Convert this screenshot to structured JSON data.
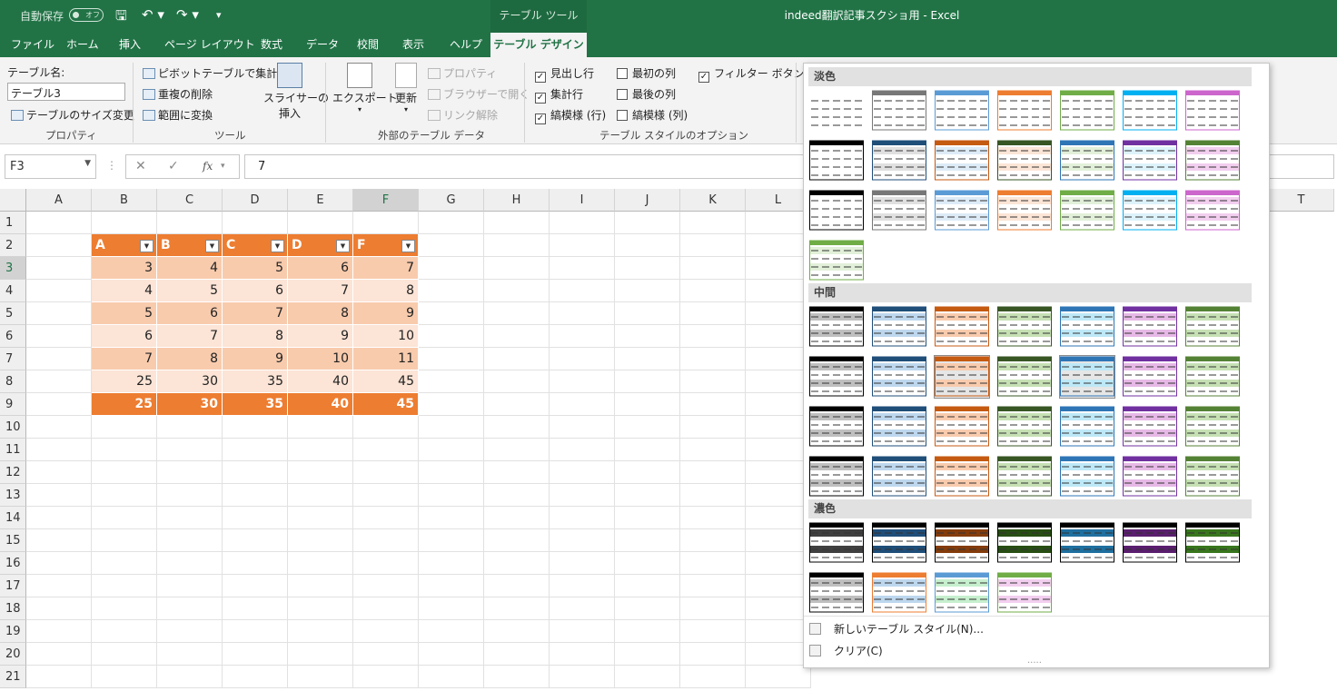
{
  "titlebar": {
    "autosave": "自動保存",
    "toggle": "オフ",
    "tool_tab": "テーブル ツール",
    "doc_title": "indeed翻訳記事スクショ用  -  Excel"
  },
  "menu": [
    "ファイル",
    "ホーム",
    "挿入",
    "ページ レイアウト",
    "数式",
    "データ",
    "校閲",
    "表示",
    "ヘルプ",
    "テーブル デザイン"
  ],
  "ribbon": {
    "prop": {
      "name_label": "テーブル名:",
      "name_value": "テーブル3",
      "resize": "テーブルのサイズ変更",
      "label": "プロパティ"
    },
    "tools": {
      "pivot": "ピボットテーブルで集計",
      "dedupe": "重複の削除",
      "convert": "範囲に変換",
      "slicer1": "スライサーの",
      "slicer2": "挿入",
      "label": "ツール"
    },
    "external": {
      "export": "エクスポート",
      "refresh": "更新",
      "properties": "プロパティ",
      "browser": "ブラウザーで開く",
      "unlink": "リンク解除",
      "label": "外部のテーブル データ"
    },
    "style_options": {
      "header_row": "見出し行",
      "total_row": "集計行",
      "banded_rows": "縞模様 (行)",
      "first_col": "最初の列",
      "last_col": "最後の列",
      "banded_cols": "縞模様 (列)",
      "filter_btn": "フィルター ボタン",
      "label": "テーブル スタイルのオプション"
    }
  },
  "formula": {
    "namebox": "F3",
    "fx": "fx",
    "value": "7"
  },
  "columns": [
    "A",
    "B",
    "C",
    "D",
    "E",
    "F",
    "G",
    "H",
    "I",
    "J",
    "K",
    "L",
    "T"
  ],
  "rows": [
    "1",
    "2",
    "3",
    "4",
    "5",
    "6",
    "7",
    "8",
    "9",
    "10",
    "11",
    "12",
    "13",
    "14",
    "15",
    "16",
    "17",
    "18",
    "19",
    "20",
    "21"
  ],
  "table": {
    "headers": [
      "A",
      "B",
      "C",
      "D",
      "F"
    ],
    "data": [
      [
        "3",
        "4",
        "5",
        "6",
        "7"
      ],
      [
        "4",
        "5",
        "6",
        "7",
        "8"
      ],
      [
        "5",
        "6",
        "7",
        "8",
        "9"
      ],
      [
        "6",
        "7",
        "8",
        "9",
        "10"
      ],
      [
        "7",
        "8",
        "9",
        "10",
        "11"
      ],
      [
        "25",
        "30",
        "35",
        "40",
        "45"
      ]
    ],
    "totals": [
      "25",
      "30",
      "35",
      "40",
      "45"
    ]
  },
  "gallery": {
    "light": "淡色",
    "medium": "中間",
    "dark": "濃色",
    "new_style": "新しいテーブル スタイル(N)...",
    "clear": "クリア(C)",
    "grip": "....."
  },
  "colors": {
    "accent": "#217346",
    "table_header": "#ed7d31",
    "band1": "#f8cbad",
    "band2": "#fce4d6"
  }
}
